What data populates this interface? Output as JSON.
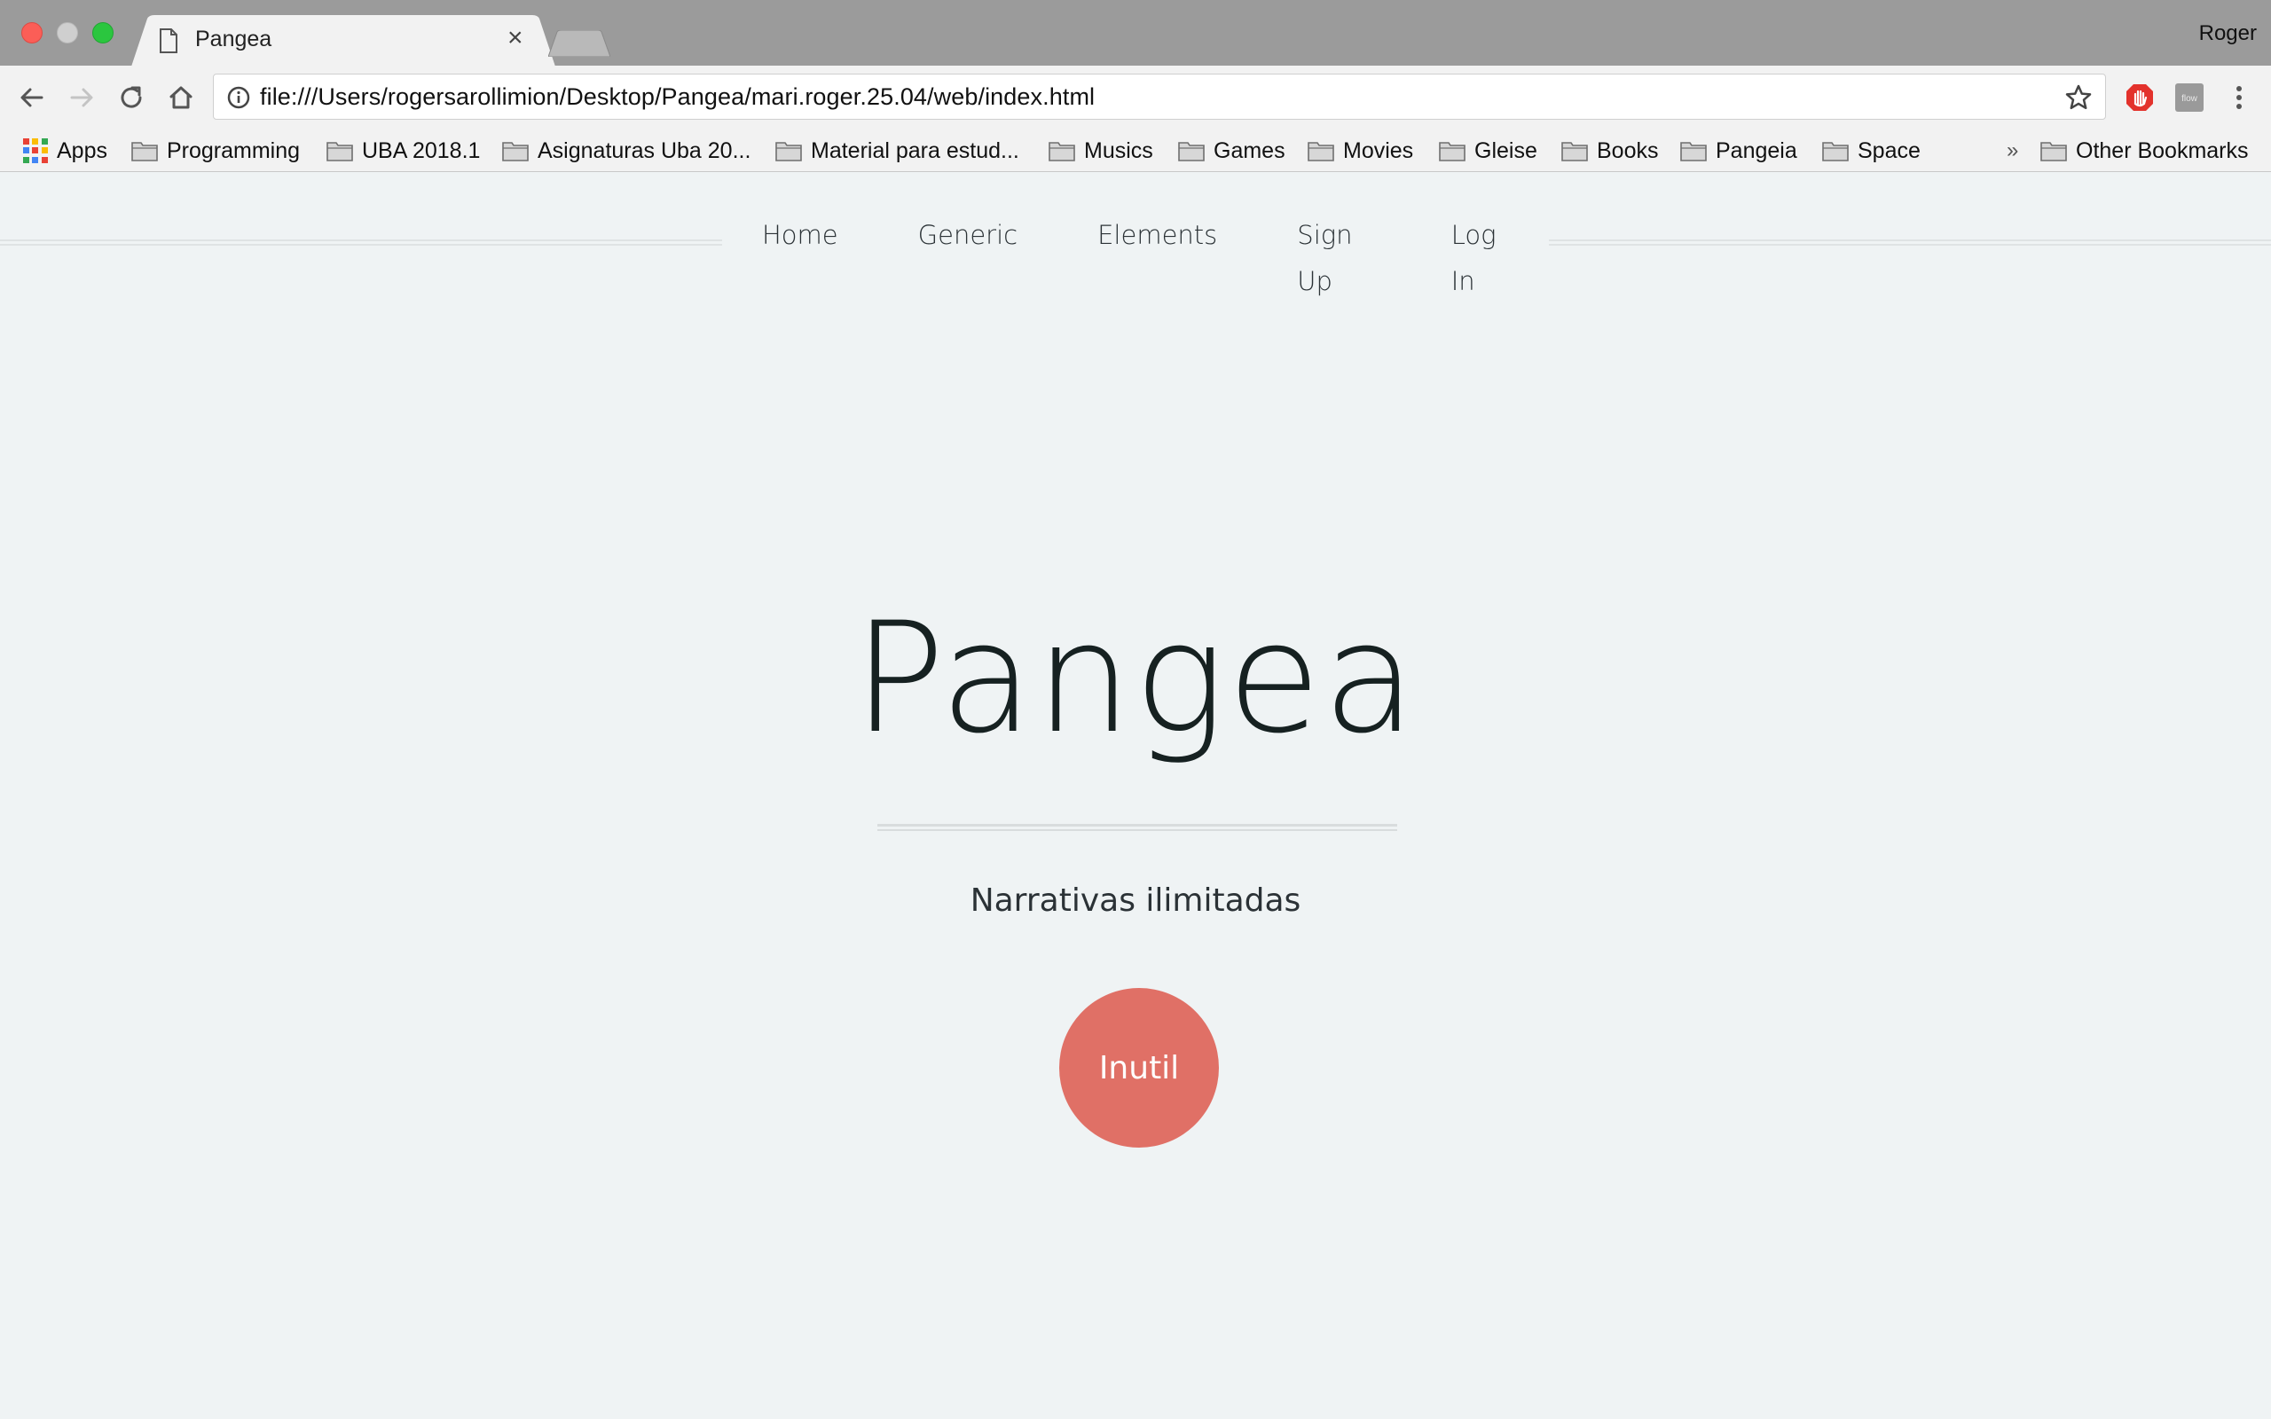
{
  "browser": {
    "tab": {
      "title": "Pangea",
      "close": "×"
    },
    "profile": "Roger",
    "url": "file:///Users/rogersarollimion/Desktop/Pangea/mari.roger.25.04/web/index.html",
    "extensions": [
      "adblock-icon",
      "flow-icon"
    ],
    "flow_label": "flow"
  },
  "bookmarks": {
    "items": [
      {
        "label": "Apps",
        "icon": "apps-grid-icon"
      },
      {
        "label": "Programming",
        "icon": "folder-icon"
      },
      {
        "label": "UBA 2018.1",
        "icon": "folder-icon"
      },
      {
        "label": "Asignaturas Uba 20...",
        "icon": "folder-icon"
      },
      {
        "label": "Material para estud...",
        "icon": "folder-icon"
      },
      {
        "label": "Musics",
        "icon": "folder-icon"
      },
      {
        "label": "Games",
        "icon": "folder-icon"
      },
      {
        "label": "Movies",
        "icon": "folder-icon"
      },
      {
        "label": "Gleise",
        "icon": "folder-icon"
      },
      {
        "label": "Books",
        "icon": "folder-icon"
      },
      {
        "label": "Pangeia",
        "icon": "folder-icon"
      },
      {
        "label": "Space",
        "icon": "folder-icon"
      }
    ],
    "overflow": "»",
    "other": "Other Bookmarks"
  },
  "site": {
    "nav": [
      "Home",
      "Generic",
      "Elements",
      "Sign Up",
      "Log In"
    ],
    "hero": {
      "title": "Pangea",
      "subtitle": "Narrativas ilimitadas",
      "button": "Inutil"
    }
  },
  "colors": {
    "page_bg": "#eff3f4",
    "button": "#e07066",
    "title": "#162121"
  }
}
